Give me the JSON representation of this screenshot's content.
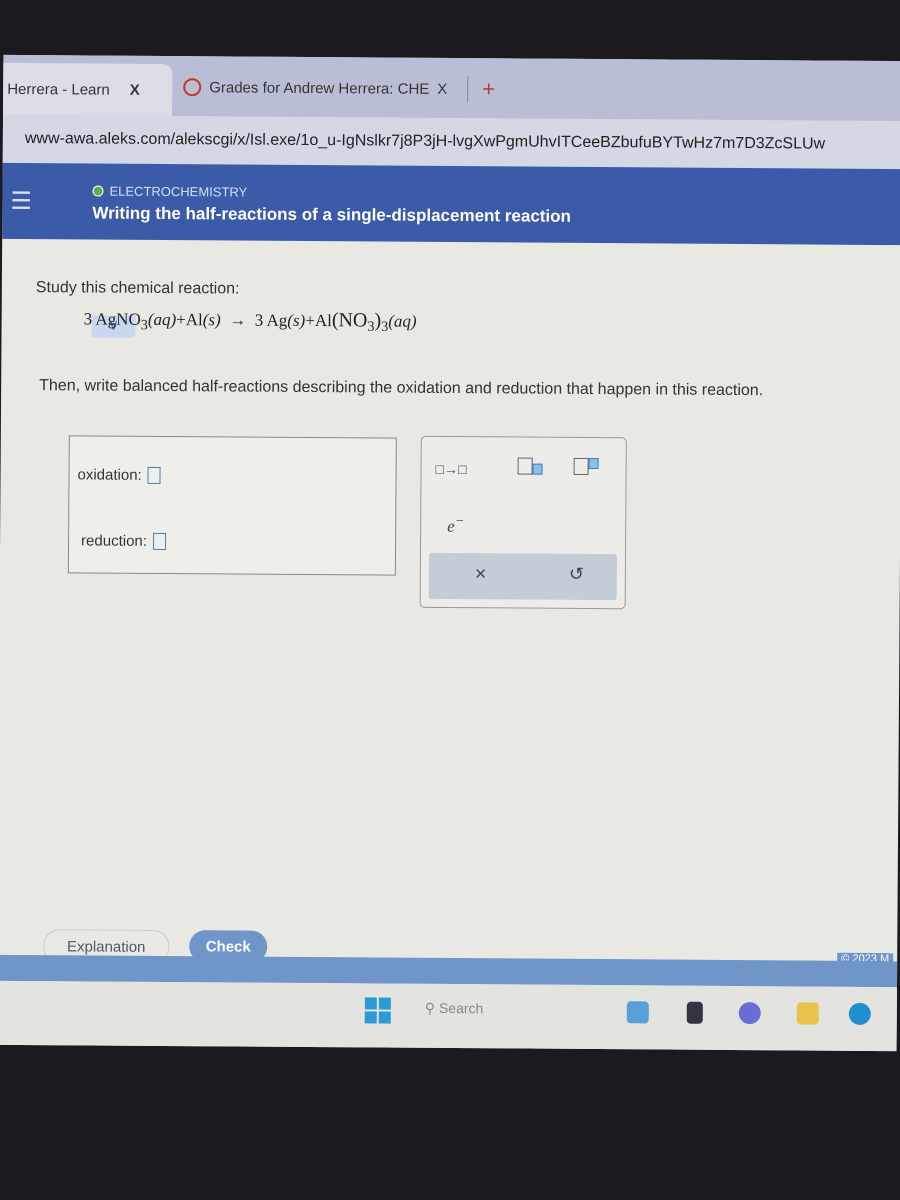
{
  "browser": {
    "tabs": [
      {
        "label": "Herrera - Learn",
        "close": "X"
      },
      {
        "label": "Grades for Andrew Herrera: CHE",
        "close": "X"
      }
    ],
    "new_tab": "+",
    "url": "www-awa.aleks.com/alekscgi/x/Isl.exe/1o_u-IgNslkr7j8P3jH-lvgXwPgmUhvITCeeBZbufuBYTwHz7m7D3ZcSLUw"
  },
  "header": {
    "topic": "ELECTROCHEMISTRY",
    "title": "Writing the half-reactions of a single-displacement reaction",
    "menu_icon": "hamburger-icon"
  },
  "question": {
    "intro": "Study this chemical reaction:",
    "equation": {
      "r1": "3 AgNO",
      "r1_sub": "3",
      "r1_state": "(aq)",
      "plus1": "+",
      "r2": "Al",
      "r2_state": "(s)",
      "arrow": "→",
      "p1": "3 Ag",
      "p1_state": "(s)",
      "plus2": "+",
      "p2": "Al",
      "p2_paren": "(NO",
      "p2_sub": "3",
      "p2_close": ")",
      "p2_sub2": "3",
      "p2_state": "(aq)"
    },
    "instruction": "Then, write balanced half-reactions describing the oxidation and reduction that happen in this reaction."
  },
  "answer": {
    "oxidation_label": "oxidation:",
    "reduction_label": "reduction:"
  },
  "palette": {
    "arrow_tool": "□→□",
    "subscript_tool": "subscript",
    "superscript_tool": "superscript",
    "electron": "e",
    "electron_sup": "−",
    "clear": "×",
    "undo": "↺"
  },
  "buttons": {
    "explanation": "Explanation",
    "check": "Check"
  },
  "footer": {
    "copyright": "© 2023 M"
  },
  "taskbar": {
    "search": "Search"
  },
  "colors": {
    "header": "#3b5aa8",
    "accent": "#6f95c9",
    "check_button": "#6f95c9"
  }
}
